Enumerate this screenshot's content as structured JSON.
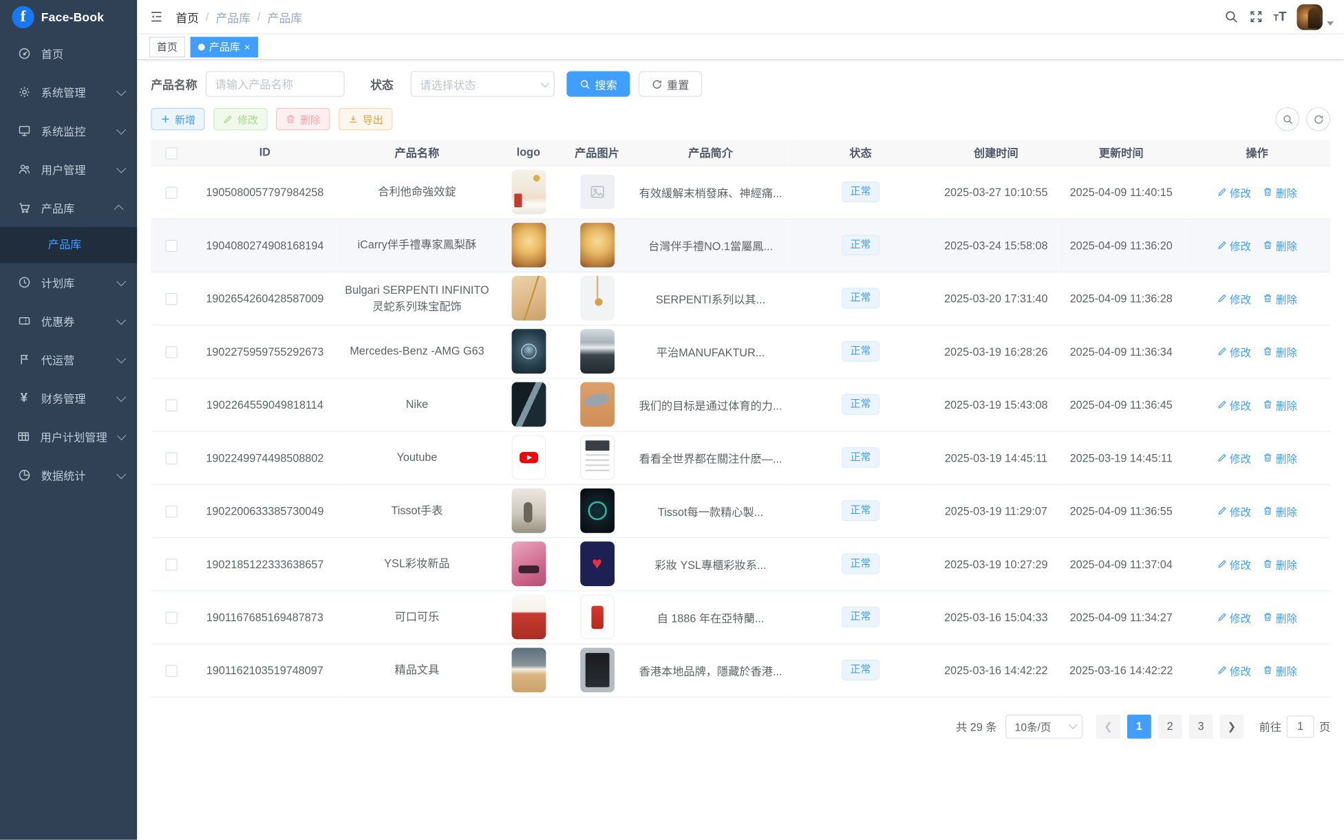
{
  "brand": {
    "name": "Face-Book",
    "logo_letter": "f"
  },
  "colors": {
    "accent": "#409eff",
    "sidebar_bg": "#304156",
    "sidebar_active_bg": "#1f2d3d",
    "sidebar_text": "#bfcbd9",
    "status_badge_bg": "#ecf5ff",
    "status_badge_text": "#409eff"
  },
  "sidebar": {
    "items": [
      {
        "label": "首页",
        "icon": "dashboard-icon",
        "has_arrow": false
      },
      {
        "label": "系统管理",
        "icon": "gear-icon",
        "has_arrow": true
      },
      {
        "label": "系统监控",
        "icon": "monitor-icon",
        "has_arrow": true
      },
      {
        "label": "用户管理",
        "icon": "users-icon",
        "has_arrow": true
      },
      {
        "label": "产品库",
        "icon": "cart-icon",
        "has_arrow": true,
        "expanded": true,
        "children": [
          {
            "label": "产品库",
            "active": true
          }
        ]
      },
      {
        "label": "计划库",
        "icon": "clock-icon",
        "has_arrow": true
      },
      {
        "label": "优惠券",
        "icon": "coupon-icon",
        "has_arrow": true
      },
      {
        "label": "代运营",
        "icon": "operations-icon",
        "has_arrow": true
      },
      {
        "label": "财务管理",
        "icon": "finance-icon",
        "has_arrow": true
      },
      {
        "label": "用户计划管理",
        "icon": "user-plan-icon",
        "has_arrow": true
      },
      {
        "label": "数据统计",
        "icon": "stats-icon",
        "has_arrow": true
      }
    ]
  },
  "topbar": {
    "breadcrumb": [
      "首页",
      "产品库",
      "产品库"
    ]
  },
  "tabs": [
    {
      "label": "首页",
      "active": false
    },
    {
      "label": "产品库",
      "active": true
    }
  ],
  "filters": {
    "name_label": "产品名称",
    "name_placeholder": "请输入产品名称",
    "status_label": "状态",
    "status_placeholder": "请选择状态",
    "search_label": "搜索",
    "reset_label": "重置"
  },
  "toolbar": {
    "add_label": "新增",
    "edit_label": "修改",
    "delete_label": "删除",
    "export_label": "导出"
  },
  "table": {
    "columns": [
      "ID",
      "产品名称",
      "logo",
      "产品图片",
      "产品简介",
      "状态",
      "创建时间",
      "更新时间",
      "操作"
    ],
    "edit_label": "修改",
    "delete_label": "删除",
    "rows": [
      {
        "id": "1905080057797984258",
        "name": "合利他命強效錠",
        "logo_thumb": "medicine-box-photo",
        "image_thumb": "image-placeholder",
        "intro": "有效緩解末梢發麻、神經痛...",
        "status": "正常",
        "created": "2025-03-27 10:10:55",
        "updated": "2025-04-09 11:40:15",
        "highlighted": false
      },
      {
        "id": "1904080274908168194",
        "name": "iCarry伴手禮專家鳳梨酥",
        "logo_thumb": "pineapple-cake-photo",
        "image_thumb": "pineapple-cake-photo",
        "intro": "台灣伴手禮NO.1當屬鳳...",
        "status": "正常",
        "created": "2025-03-24 15:58:08",
        "updated": "2025-04-09 11:36:20",
        "highlighted": true
      },
      {
        "id": "1902654260428587009",
        "name": "Bulgari SERPENTI INFINITO灵蛇系列珠宝配饰",
        "logo_thumb": "gold-necklace-photo",
        "image_thumb": "pendant-photo",
        "intro": "SERPENTI系列以其...",
        "status": "正常",
        "created": "2025-03-20 17:31:40",
        "updated": "2025-04-09 11:36:28",
        "highlighted": false
      },
      {
        "id": "1902275959755292673",
        "name": "Mercedes-Benz -AMG G63",
        "logo_thumb": "mercedes-logo-photo",
        "image_thumb": "gwagon-photo",
        "intro": "平治MANUFAKTUR...",
        "status": "正常",
        "created": "2025-03-19 16:28:26",
        "updated": "2025-04-09 11:36:34",
        "highlighted": false
      },
      {
        "id": "1902264559049818114",
        "name": "Nike",
        "logo_thumb": "nike-collage-photo",
        "image_thumb": "sneaker-photo",
        "intro": "我们的目标是通过体育的力...",
        "status": "正常",
        "created": "2025-03-19 15:43:08",
        "updated": "2025-04-09 11:36:45",
        "highlighted": false
      },
      {
        "id": "1902249974498508802",
        "name": "Youtube",
        "logo_thumb": "youtube-logo",
        "image_thumb": "phone-screenshot",
        "intro": "看看全世界都在關注什麽—...",
        "status": "正常",
        "created": "2025-03-19 14:45:11",
        "updated": "2025-03-19 14:45:11",
        "highlighted": false
      },
      {
        "id": "1902200633385730049",
        "name": "Tissot手表",
        "logo_thumb": "watch-city-photo",
        "image_thumb": "watch-face-photo",
        "intro": "Tissot每一款精心製...",
        "status": "正常",
        "created": "2025-03-19 11:29:07",
        "updated": "2025-04-09 11:36:55",
        "highlighted": false
      },
      {
        "id": "1902185122333638657",
        "name": "YSL彩妆新品",
        "logo_thumb": "lipstick-photo",
        "image_thumb": "ysl-heart-photo",
        "intro": "彩妝 YSL專櫃彩妝系...",
        "status": "正常",
        "created": "2025-03-19 10:27:29",
        "updated": "2025-04-09 11:37:04",
        "highlighted": false
      },
      {
        "id": "1901167685169487873",
        "name": "可口可乐",
        "logo_thumb": "coke-crate-photo",
        "image_thumb": "coke-can-photo",
        "intro": "自 1886 年在亞特蘭...",
        "status": "正常",
        "created": "2025-03-16 15:04:33",
        "updated": "2025-04-09 11:34:27",
        "highlighted": false
      },
      {
        "id": "1901162103519748097",
        "name": "精品文具",
        "logo_thumb": "stationery-photo",
        "image_thumb": "poster-frame-photo",
        "intro": "香港本地品牌，隱藏於香港...",
        "status": "正常",
        "created": "2025-03-16 14:42:22",
        "updated": "2025-03-16 14:42:22",
        "highlighted": false
      }
    ]
  },
  "pagination": {
    "total_text": "共 29 条",
    "page_size": "10条/页",
    "pages": [
      "1",
      "2",
      "3"
    ],
    "current": "1",
    "goto_label": "前往",
    "goto_value": "1",
    "page_unit": "页"
  }
}
